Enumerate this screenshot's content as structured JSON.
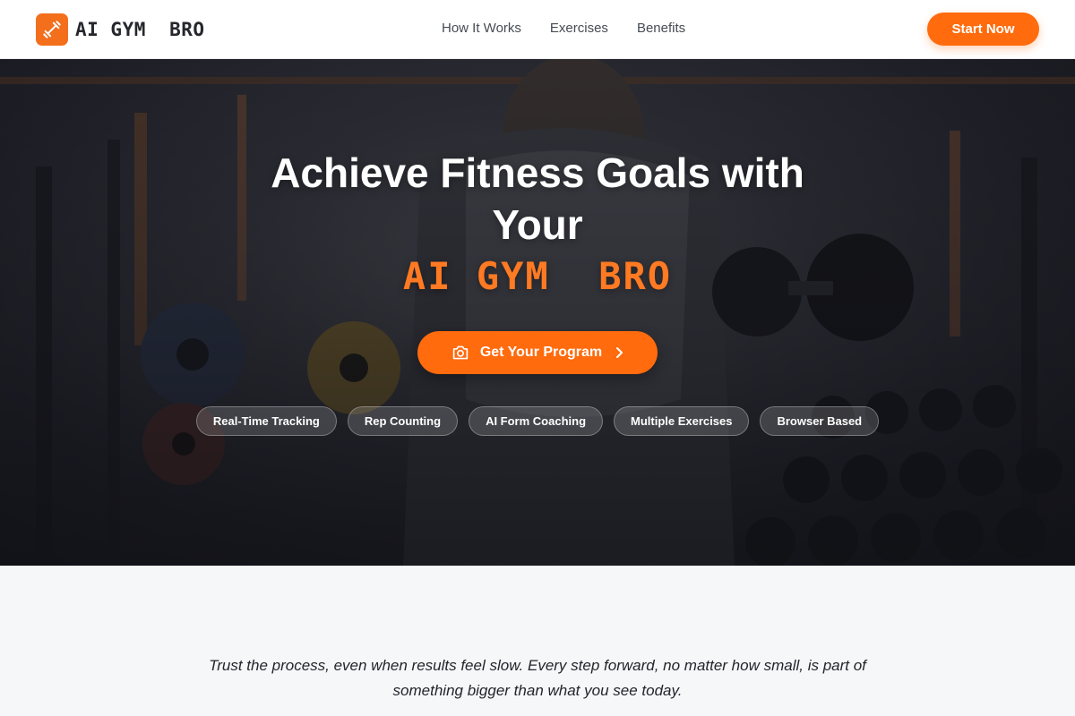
{
  "brand": {
    "name": "AI GYM  BRO",
    "accent": "#ff6b0d",
    "logo_icon": "dumbbell-icon"
  },
  "nav": {
    "links": [
      "How It Works",
      "Exercises",
      "Benefits"
    ],
    "cta": "Start Now"
  },
  "hero": {
    "title": "Achieve Fitness Goals with Your",
    "brand": "AI GYM  BRO",
    "cta": {
      "label": "Get Your Program",
      "icon": "camera-icon",
      "trailing_icon": "chevron-right-icon"
    },
    "tags": [
      "Real-Time Tracking",
      "Rep Counting",
      "AI Form Coaching",
      "Multiple Exercises",
      "Browser Based"
    ]
  },
  "quote": "Trust the process, even when results feel slow. Every step forward, no matter how small, is part of something bigger than what you see today."
}
